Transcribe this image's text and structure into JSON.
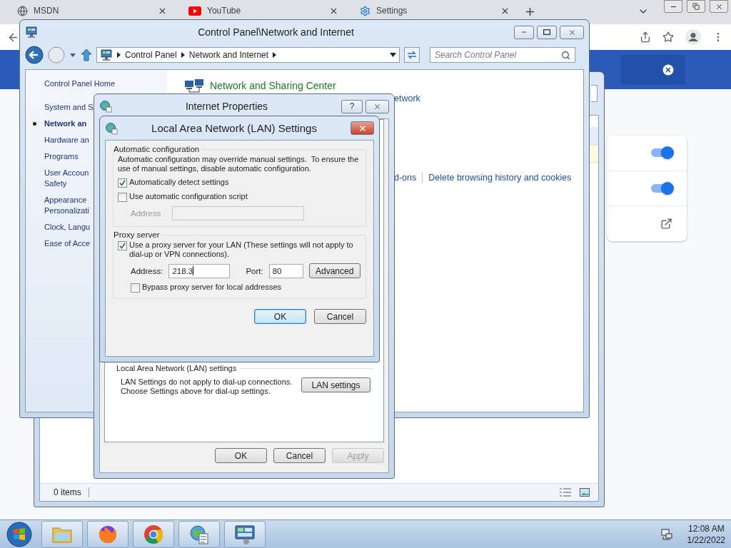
{
  "browser": {
    "tabs": [
      {
        "title": "MSDN"
      },
      {
        "title": "YouTube"
      },
      {
        "title": "Settings"
      }
    ],
    "settings_toggles": [
      {
        "on": true
      },
      {
        "on": true
      }
    ]
  },
  "background_window": {
    "status": "0 items"
  },
  "control_panel": {
    "title": "Control Panel\\Network and Internet",
    "breadcrumb": [
      "Control Panel",
      "Network and Internet"
    ],
    "search": {
      "placeholder": "Search Control Panel"
    },
    "sidebar": {
      "items": [
        {
          "label": "Control Panel Home",
          "selected": false
        },
        {
          "label": "System and S",
          "selected": false
        },
        {
          "label": "Network an",
          "selected": true
        },
        {
          "label": "Hardware an",
          "selected": false
        },
        {
          "label": "Programs",
          "selected": false
        },
        {
          "label": "User Accoun\nSafety",
          "selected": false
        },
        {
          "label": "Appearance\nPersonalizati",
          "selected": false
        },
        {
          "label": "Clock, Langu",
          "selected": false
        },
        {
          "label": "Ease of Acce",
          "selected": false
        }
      ]
    },
    "sections": [
      {
        "heading": "Network and Sharing Center",
        "links": [
          "etwork"
        ]
      },
      {
        "links": [
          "d-ons",
          "Delete browsing history and cookies"
        ]
      }
    ]
  },
  "internet_properties": {
    "title": "Internet Properties",
    "help_button": "?",
    "lan_group": {
      "heading": "Local Area Network (LAN) settings",
      "text": "LAN Settings do not apply to dial-up connections.\nChoose Settings above for dial-up settings.",
      "button": "LAN settings"
    },
    "buttons": [
      {
        "label": "OK",
        "disabled": false
      },
      {
        "label": "Cancel",
        "disabled": false
      },
      {
        "label": "Apply",
        "disabled": true
      }
    ]
  },
  "lan_dialog": {
    "title": "Local Area Network (LAN) Settings",
    "automatic": {
      "heading": "Automatic configuration",
      "note": "Automatic configuration may override manual settings.  To ensure the\nuse of manual settings, disable automatic configuration.",
      "options": [
        {
          "label": "Automatically detect settings",
          "checked": true
        },
        {
          "label": "Use automatic configuration script",
          "checked": false
        }
      ],
      "address": {
        "label": "Address",
        "disabled": true
      }
    },
    "proxy": {
      "heading": "Proxy server",
      "use_proxy": {
        "label": "Use a proxy server for your LAN (These settings will not apply to\ndial-up or VPN connections).",
        "checked": true
      },
      "address": {
        "label": "Address:",
        "value": "218.3"
      },
      "port": {
        "label": "Port:",
        "value": "80"
      },
      "advanced_button": "Advanced",
      "bypass": {
        "label": "Bypass proxy server for local addresses",
        "checked": false
      }
    },
    "buttons": [
      {
        "label": "OK",
        "focused": true
      },
      {
        "label": "Cancel",
        "focused": false
      }
    ]
  },
  "taskbar": {
    "apps": [
      {
        "kind": "explorer"
      },
      {
        "kind": "firefox"
      },
      {
        "kind": "chrome"
      },
      {
        "kind": "internet-options"
      },
      {
        "kind": "control-panel"
      }
    ],
    "clock": {
      "time": "12:08 AM",
      "date": "1/22/2022"
    }
  }
}
